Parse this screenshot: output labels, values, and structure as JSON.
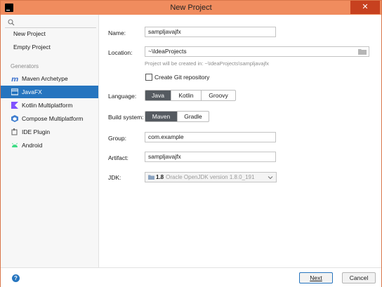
{
  "window": {
    "title": "New Project"
  },
  "sidebar": {
    "search_placeholder": "",
    "items": [
      "New Project",
      "Empty Project"
    ],
    "generators_heading": "Generators",
    "generators": [
      {
        "label": "Maven Archetype",
        "icon": "maven-icon",
        "color": "#4a7bd0"
      },
      {
        "label": "JavaFX",
        "icon": "javafx-icon",
        "color": "#ffffff"
      },
      {
        "label": "Kotlin Multiplatform",
        "icon": "kotlin-icon",
        "color": "#7f52ff"
      },
      {
        "label": "Compose Multiplatform",
        "icon": "compose-icon",
        "color": "#3f7ecf"
      },
      {
        "label": "IDE Plugin",
        "icon": "plugin-icon",
        "color": "#6d6d6d"
      },
      {
        "label": "Android",
        "icon": "android-icon",
        "color": "#3ddc84"
      }
    ],
    "selected": "JavaFX"
  },
  "form": {
    "name_label": "Name:",
    "name_value": "sampljavajfx",
    "location_label": "Location:",
    "location_value": "~\\IdeaProjects",
    "location_hint": "Project will be created in: ~\\IdeaProjects\\sampljavajfx",
    "git_label": "Create Git repository",
    "language_label": "Language:",
    "languages": [
      "Java",
      "Kotlin",
      "Groovy"
    ],
    "language_selected": "Java",
    "build_label": "Build system:",
    "builds": [
      "Maven",
      "Gradle"
    ],
    "build_selected": "Maven",
    "group_label": "Group:",
    "group_value": "com.example",
    "artifact_label": "Artifact:",
    "artifact_value": "sampljavajfx",
    "jdk_label": "JDK:",
    "jdk_version": "1.8",
    "jdk_detail": "Oracle OpenJDK version 1.8.0_191"
  },
  "footer": {
    "help_label": "?",
    "next_label": "Next",
    "cancel_label": "Cancel"
  },
  "colors": {
    "titlebar": "#f08c5e",
    "close": "#c7411f",
    "accent": "#2675bf"
  }
}
